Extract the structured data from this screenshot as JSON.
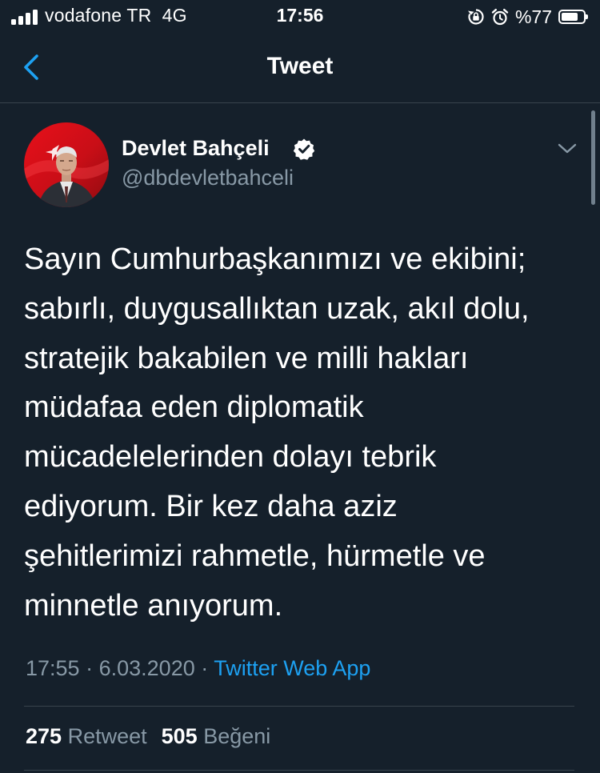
{
  "status_bar": {
    "carrier": "vodafone TR",
    "network": "4G",
    "time": "17:56",
    "battery_percent": "%77",
    "battery_level": 0.77,
    "icons": [
      "signal-icon",
      "rotation-lock-icon",
      "alarm-icon",
      "battery-icon"
    ]
  },
  "nav": {
    "title": "Tweet",
    "back_icon": "chevron-left-icon"
  },
  "tweet": {
    "author_name": "Devlet Bahçeli",
    "handle": "@dbdevletbahceli",
    "verified": true,
    "text_lines": [
      "Sayın Cumhurbaşkanımızı ve ekibini;",
      "sabırlı, duygusallıktan uzak, akıl dolu,",
      "stratejik bakabilen ve milli hakları",
      "müdafaa eden diplomatik",
      "mücadelelerinden dolayı tebrik",
      "ediyorum. Bir kez daha aziz",
      "şehitlerimizi rahmetle, hürmetle ve",
      "minnetle anıyorum."
    ],
    "time": "17:55",
    "separator": "·",
    "date": "6.03.2020",
    "source": "Twitter Web App"
  },
  "stats": {
    "retweets": "275",
    "retweets_label": "Retweet",
    "likes": "505",
    "likes_label": "Beğeni"
  },
  "colors": {
    "background": "#15202b",
    "accent": "#1da1f2",
    "secondary_text": "#8899a6",
    "divider": "#38444d"
  }
}
